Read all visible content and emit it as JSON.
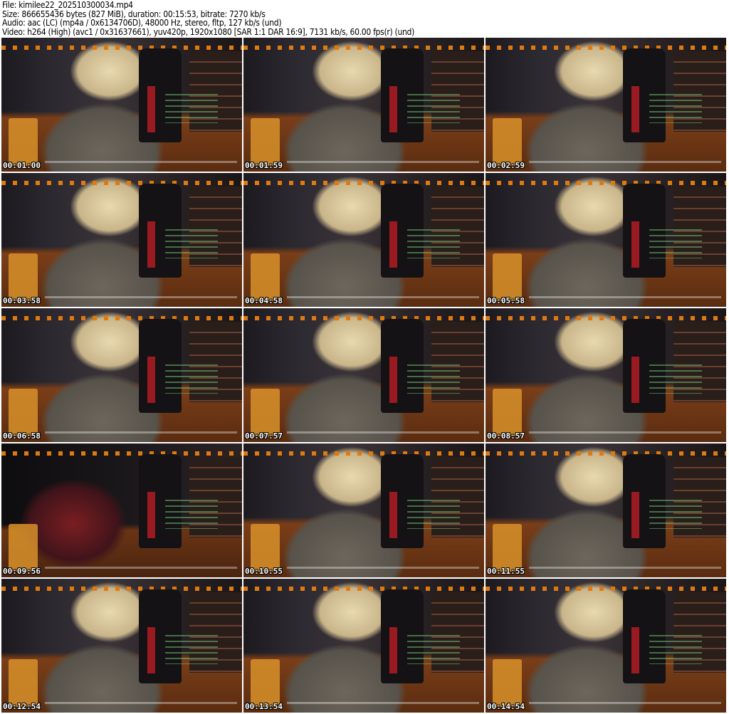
{
  "header": {
    "file": "File: kimilee22_202510300034.mp4",
    "size": "Size: 866655436 bytes (827 MiB), duration: 00:15:53, bitrate: 7270 kb/s",
    "audio": "Audio: aac (LC) (mp4a / 0x6134706D), 48000 Hz, stereo, fltp, 127 kb/s (und)",
    "video": "Video: h264 (High) (avc1 / 0x31637661), yuv420p, 1920x1080 [SAR 1:1 DAR 16:9], 7131 kb/s, 60.00 fps(r) (und)"
  },
  "thumbnails": [
    {
      "timestamp": "00:01:00"
    },
    {
      "timestamp": "00:01:59"
    },
    {
      "timestamp": "00:02:59"
    },
    {
      "timestamp": "00:03:58"
    },
    {
      "timestamp": "00:04:58"
    },
    {
      "timestamp": "00:05:58"
    },
    {
      "timestamp": "00:06:58"
    },
    {
      "timestamp": "00:07:57"
    },
    {
      "timestamp": "00:08:57"
    },
    {
      "timestamp": "00:09:56"
    },
    {
      "timestamp": "00:10:55"
    },
    {
      "timestamp": "00:11:55"
    },
    {
      "timestamp": "00:12:54"
    },
    {
      "timestamp": "00:13:54"
    },
    {
      "timestamp": "00:14:54"
    }
  ]
}
